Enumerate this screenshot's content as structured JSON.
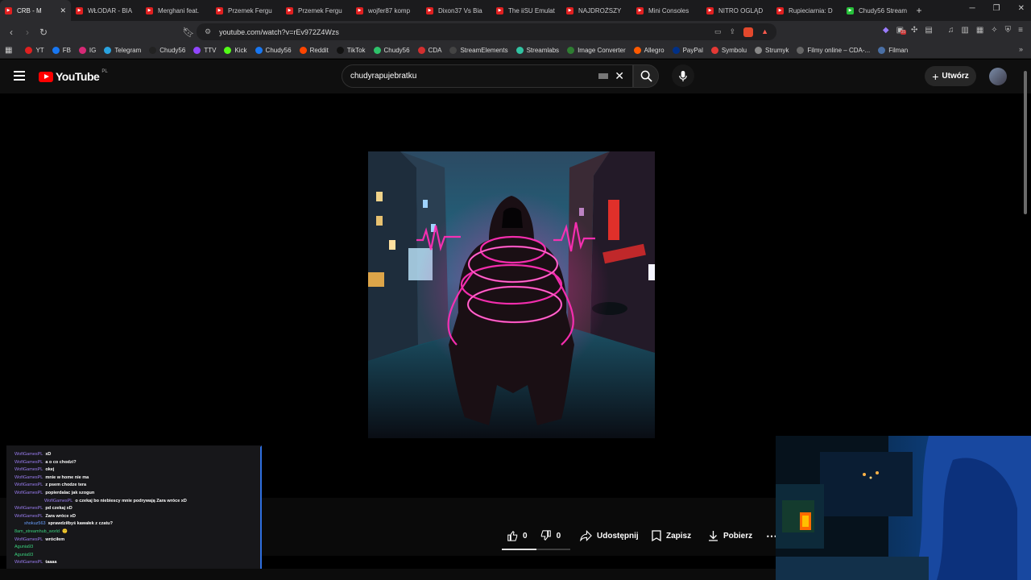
{
  "browser": {
    "tabs": [
      {
        "label": "CRB - M",
        "active": true
      },
      {
        "label": "WŁODAR - BIA"
      },
      {
        "label": "Merghani feat."
      },
      {
        "label": "Przemek Fergu"
      },
      {
        "label": "Przemek Fergu"
      },
      {
        "label": "wojfer87 komp"
      },
      {
        "label": "Dixon37 Vs Bia"
      },
      {
        "label": "The iiSU Emulat"
      },
      {
        "label": "NAJDROŻSZY"
      },
      {
        "label": "Mini Consoles"
      },
      {
        "label": "NITRO OGLĄD"
      },
      {
        "label": "Rupieciarnia: D"
      },
      {
        "label": "Chudy56 Stream"
      }
    ],
    "new_tab": "+",
    "url": "youtube.com/watch?v=rEv972Z4Wzs",
    "ext_badge": "35",
    "bookmarks": [
      {
        "label": "YT",
        "color": "#e02020"
      },
      {
        "label": "FB",
        "color": "#1877f2"
      },
      {
        "label": "IG",
        "color": "#d62976"
      },
      {
        "label": "Telegram",
        "color": "#2aa3df"
      },
      {
        "label": "Chudy56",
        "color": "#222222"
      },
      {
        "label": "TTV",
        "color": "#9146ff"
      },
      {
        "label": "Kick",
        "color": "#53fc18"
      },
      {
        "label": "Chudy56",
        "color": "#1877f2"
      },
      {
        "label": "Reddit",
        "color": "#ff4500"
      },
      {
        "label": "TikTok",
        "color": "#111111"
      },
      {
        "label": "Chudy56",
        "color": "#2ec26a"
      },
      {
        "label": "CDA",
        "color": "#d32f2f"
      },
      {
        "label": "StreamElements",
        "color": "#444444"
      },
      {
        "label": "Streamlabs",
        "color": "#31c3a2"
      },
      {
        "label": "Image Converter",
        "color": "#2e7d32"
      },
      {
        "label": "Allegro",
        "color": "#ff5a00"
      },
      {
        "label": "PayPal",
        "color": "#003087"
      },
      {
        "label": "Symbolu",
        "color": "#e53935"
      },
      {
        "label": "Strumyk",
        "color": "#888888"
      },
      {
        "label": "Filmy online – CDA-...",
        "color": "#666666"
      },
      {
        "label": "Filman",
        "color": "#4a6fa5"
      }
    ]
  },
  "youtube": {
    "logo_text": "YouTube",
    "logo_region": "PL",
    "search_query": "chudyrapujebratku",
    "create_label": "Utwórz",
    "actions": {
      "likes": "0",
      "dislikes": "0",
      "share": "Udostępnij",
      "save": "Zapisz",
      "download": "Pobierz"
    }
  },
  "chat": {
    "messages": [
      {
        "user": "WofiGamesPL",
        "text": "xD",
        "cls": ""
      },
      {
        "user": "WofiGamesPL",
        "text": "a o co chodzi?",
        "cls": ""
      },
      {
        "user": "WofiGamesPL",
        "text": "okej",
        "cls": ""
      },
      {
        "user": "WofiGamesPL",
        "text": "mnie w home nie ma",
        "cls": ""
      },
      {
        "user": "WofiGamesPL",
        "text": "z psem chodze tera",
        "cls": ""
      },
      {
        "user": "WofiGamesPL",
        "text": "popierdalac jak szogun",
        "cls": ""
      },
      {
        "user": "WofiGamesPL",
        "text": "o czekaj bo niebiescy mnie podrywają Zara wróce xD",
        "cls": "",
        "indent": true
      },
      {
        "user": "WofiGamesPL",
        "text": "pd czekaj xD",
        "cls": ""
      },
      {
        "user": "WofiGamesPL",
        "text": "Zara wróce xD",
        "cls": ""
      },
      {
        "user": "shokuz563",
        "text": "sprawdziłbyś kawałek z czatu?",
        "cls": "b",
        "indent2": true
      },
      {
        "user": "8am_streamhub_world",
        "text": "🙂",
        "cls": "g"
      },
      {
        "user": "WofiGamesPL",
        "text": "wróciłem",
        "cls": ""
      },
      {
        "user": "Agunia93",
        "text": "",
        "cls": "g"
      },
      {
        "user": "Agunia93",
        "text": "",
        "cls": "g"
      },
      {
        "user": "WofiGamesPL",
        "text": "taaaa",
        "cls": ""
      }
    ]
  }
}
